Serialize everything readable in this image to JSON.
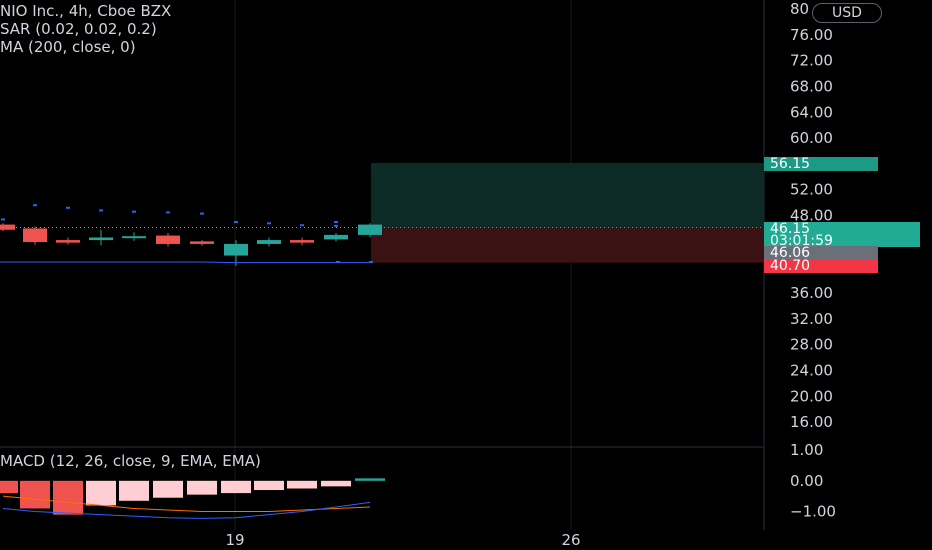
{
  "legend": {
    "main": "NIO Inc., 4h, Cboe BZX",
    "sar": "SAR (0.02, 0.02, 0.2)",
    "ma": "MA (200, close, 0)",
    "macd": "MACD (12, 26, close, 9, EMA, EMA)"
  },
  "currency_button": "USD",
  "price_axis": {
    "labels": [
      "80",
      "76.00",
      "72.00",
      "68.00",
      "64.00",
      "60.00",
      "52.00",
      "48.00",
      "36.00",
      "32.00",
      "28.00",
      "24.00",
      "20.00",
      "16.00"
    ]
  },
  "macd_axis": {
    "labels": [
      "1.00",
      "0.00",
      "−1.00"
    ]
  },
  "time_axis": {
    "labels": [
      "19",
      "26"
    ]
  },
  "price_tags": {
    "target": "56.15",
    "current": "46.15",
    "countdown": "03:01:59",
    "entry": "46.06",
    "stop": "40.70"
  },
  "colors": {
    "background": "#000000",
    "up": "#26a69a",
    "down": "#ef5350",
    "target_zone": "#0c2b27",
    "stop_zone": "#3a1214",
    "ma_line": "#2962ff",
    "macd_line": "#2962ff",
    "signal_line": "#ff6d00",
    "histogram_pos": "#26a69a",
    "histogram_neg_light": "#ffcdd2",
    "histogram_neg": "#ef5350",
    "axis_text": "#d1d4dc"
  },
  "chart_data": {
    "type": "candlestick",
    "candles": [
      {
        "open": 46.6,
        "close": 45.8,
        "high": 46.8,
        "low": 45.6,
        "dir": "down"
      },
      {
        "open": 46.0,
        "close": 43.9,
        "high": 46.3,
        "low": 43.5,
        "dir": "down"
      },
      {
        "open": 44.2,
        "close": 43.8,
        "high": 44.6,
        "low": 43.5,
        "dir": "down"
      },
      {
        "open": 44.2,
        "close": 44.6,
        "high": 45.8,
        "low": 43.4,
        "dir": "up"
      },
      {
        "open": 44.5,
        "close": 44.8,
        "high": 45.4,
        "low": 44.1,
        "dir": "up"
      },
      {
        "open": 44.9,
        "close": 43.6,
        "high": 45.3,
        "low": 43.2,
        "dir": "down"
      },
      {
        "open": 44.0,
        "close": 43.6,
        "high": 44.2,
        "low": 43.3,
        "dir": "down"
      },
      {
        "open": 41.8,
        "close": 43.6,
        "high": 44.2,
        "low": 40.2,
        "dir": "up"
      },
      {
        "open": 43.6,
        "close": 44.2,
        "high": 44.6,
        "low": 43.2,
        "dir": "up"
      },
      {
        "open": 44.2,
        "close": 43.8,
        "high": 44.6,
        "low": 43.4,
        "dir": "down"
      },
      {
        "open": 44.3,
        "close": 45.0,
        "high": 45.3,
        "low": 44.0,
        "dir": "up"
      },
      {
        "open": 45.0,
        "close": 46.6,
        "high": 46.8,
        "low": 44.6,
        "dir": "up"
      }
    ],
    "sar_points": [
      47.4,
      49.6,
      49.2,
      48.8,
      48.6,
      48.5,
      48.3,
      47.0,
      46.8,
      46.5,
      46.4,
      47.0,
      40.8,
      40.8
    ],
    "ma_values": [
      40.8,
      40.8,
      40.8,
      40.8,
      40.8,
      40.8,
      40.8,
      40.7,
      40.7,
      40.7,
      40.7,
      40.7
    ],
    "position": {
      "target": 56.15,
      "entry": 46.06,
      "stop": 40.7,
      "current": 46.15
    },
    "price_range": [
      14.0,
      80.8
    ],
    "macd_histogram": [
      -0.4,
      -0.9,
      -1.1,
      -0.8,
      -0.65,
      -0.55,
      -0.45,
      -0.4,
      -0.3,
      -0.25,
      -0.18,
      0.08
    ],
    "macd_line": [
      -0.9,
      -1.0,
      -1.05,
      -1.1,
      -1.15,
      -1.2,
      -1.22,
      -1.2,
      -1.1,
      -1.0,
      -0.85,
      -0.7
    ],
    "signal_line": [
      -0.5,
      -0.6,
      -0.7,
      -0.8,
      -0.9,
      -0.95,
      -1.0,
      -1.0,
      -1.0,
      -0.95,
      -0.9,
      -0.85
    ],
    "macd_range": [
      -1.6,
      1.1
    ]
  }
}
